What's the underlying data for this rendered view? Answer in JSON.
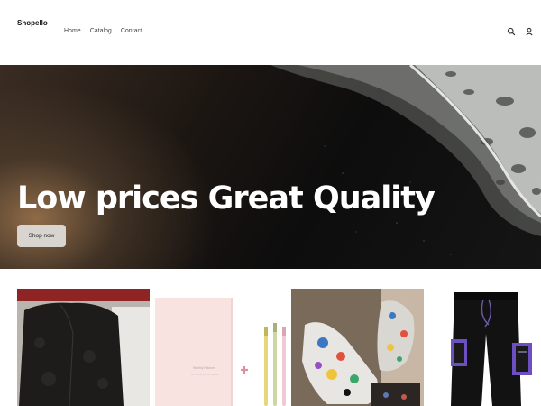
{
  "header": {
    "logo": "Shopello",
    "nav": [
      "Home",
      "Catalog",
      "Contact"
    ],
    "icons": [
      "search-icon",
      "account-icon"
    ]
  },
  "hero": {
    "title": "Low prices Great Quality",
    "button_label": "Shop now"
  },
  "products": {
    "notebook_title": "Weekly Planner",
    "notebook_subtitle": "— — — — — — —"
  }
}
